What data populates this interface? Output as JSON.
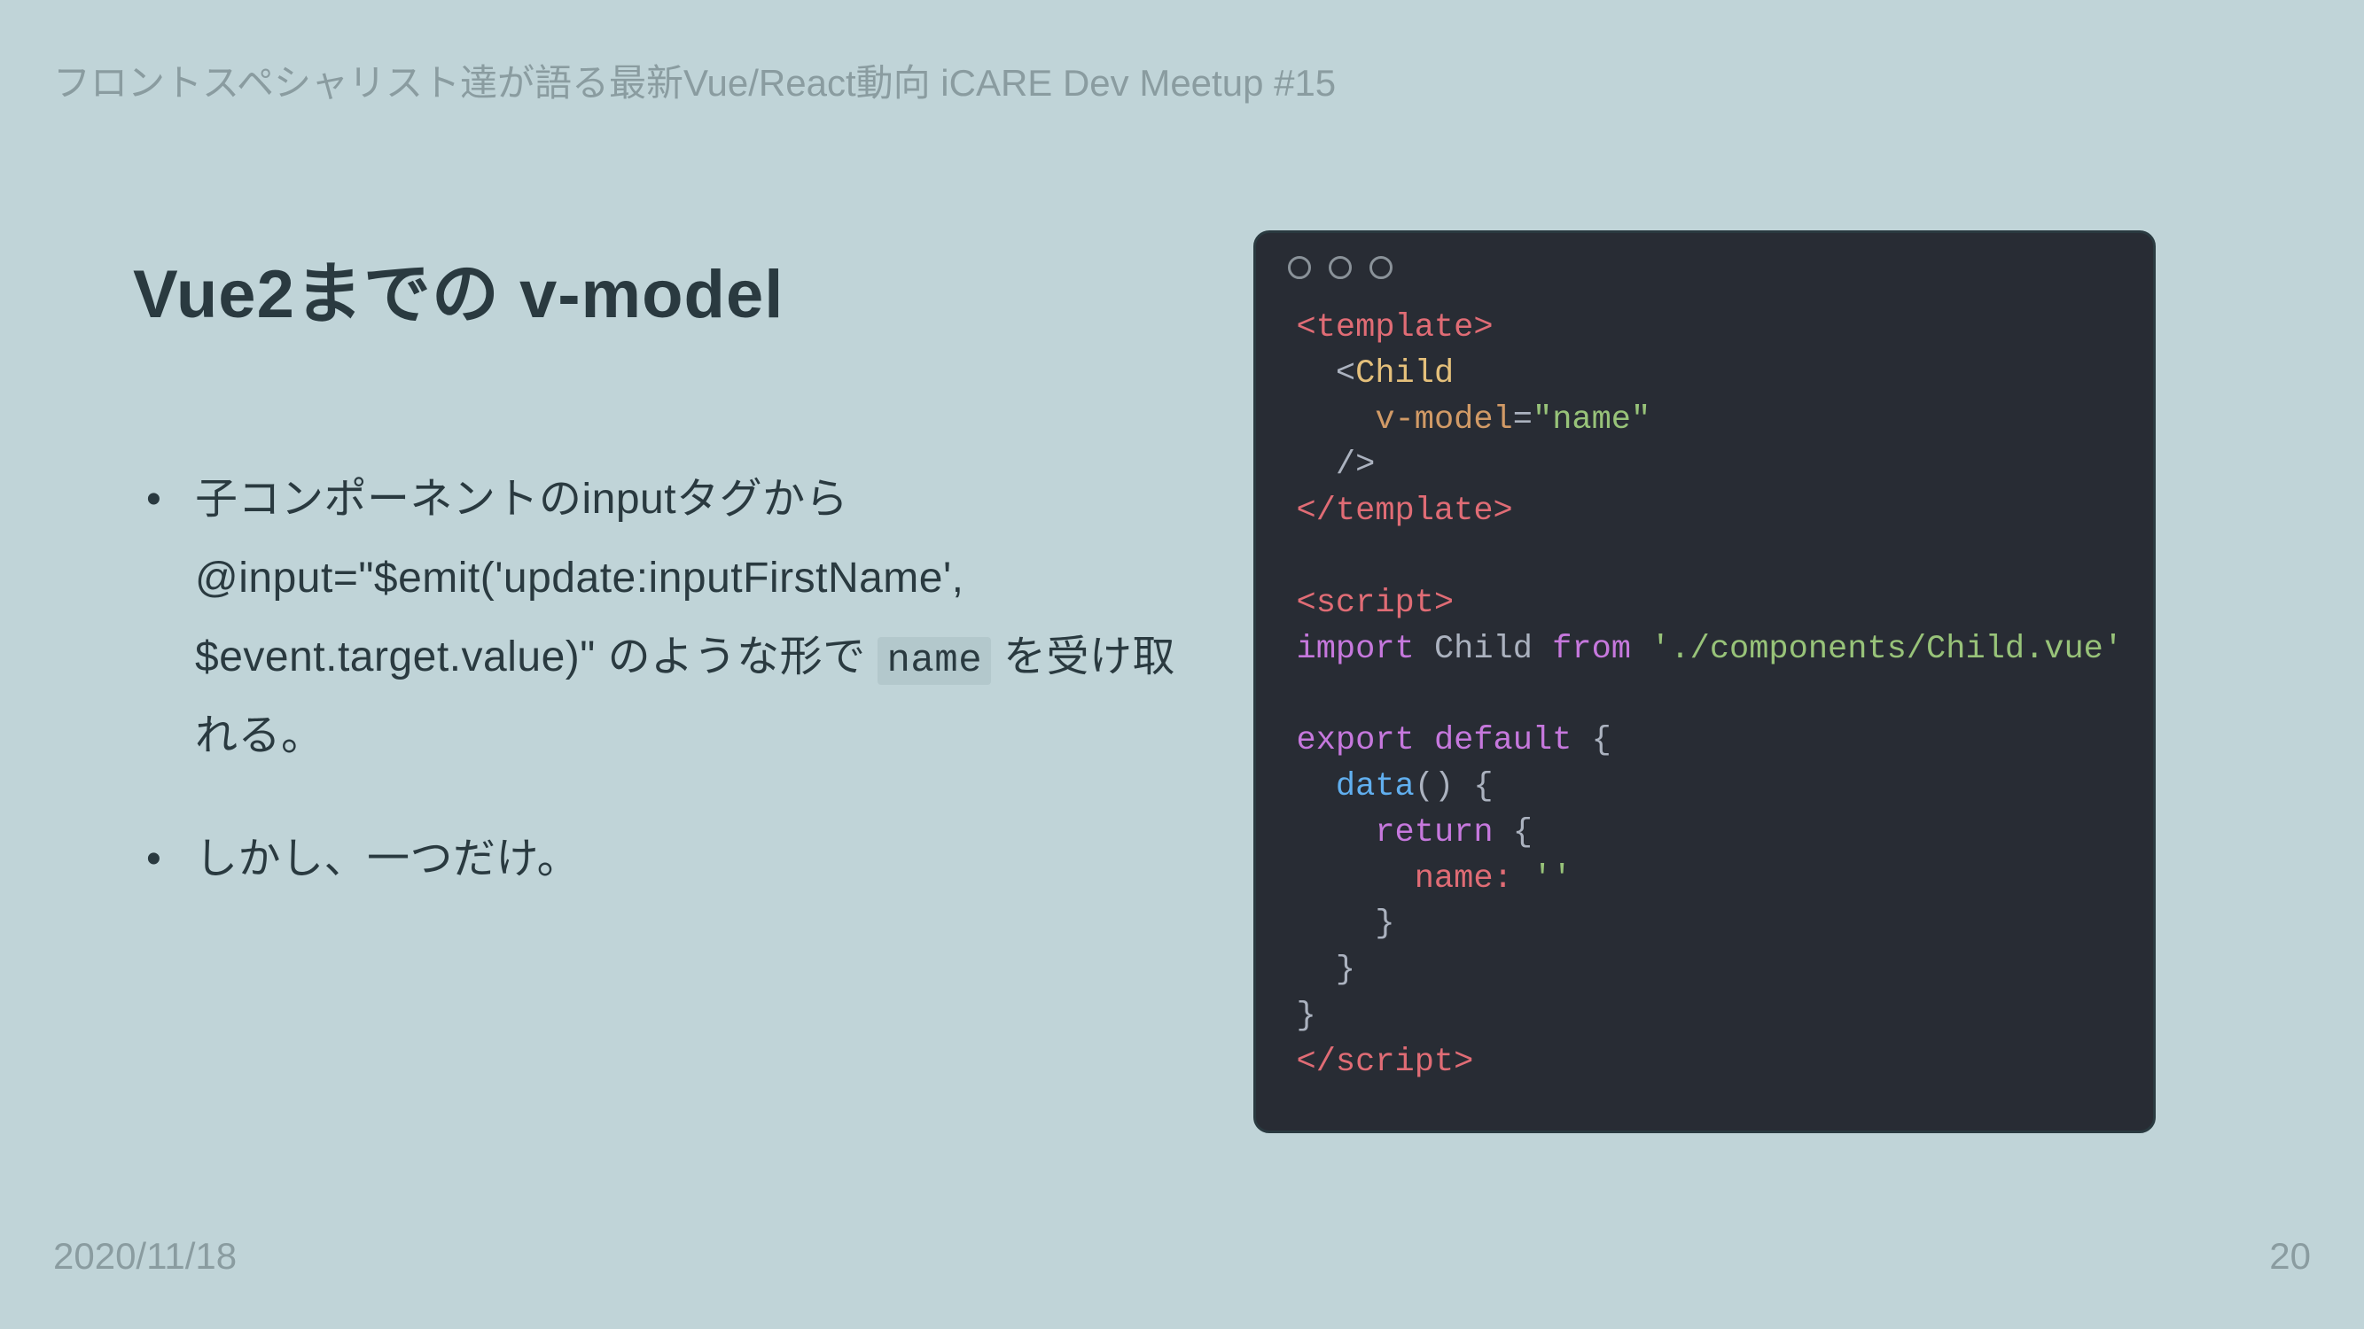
{
  "header": "フロントスペシャリスト達が語る最新Vue/React動向 iCARE Dev Meetup #15",
  "title": "Vue2までの v-model",
  "bullets": [
    {
      "pre": "子コンポーネントのinputタグから @input=\"$emit('update:inputFirstName', $event.target.value)\" のような形で ",
      "code": "name",
      "post": " を受け取れる。"
    },
    {
      "pre": "しかし、一つだけ。",
      "code": "",
      "post": ""
    }
  ],
  "code": {
    "l1": "<template>",
    "l2a": "  <",
    "l2b": "Child",
    "l3a": "    ",
    "l3b": "v-model",
    "l3c": "=",
    "l3d": "\"name\"",
    "l4": "  />",
    "l5": "</template>",
    "l6": "",
    "l7": "<script>",
    "l8a": "import",
    "l8b": " Child ",
    "l8c": "from",
    "l8d": " './components/Child.vue'",
    "l9": "",
    "l10a": "export",
    "l10b": " default",
    "l10c": " {",
    "l11a": "  ",
    "l11b": "data",
    "l11c": "() {",
    "l12a": "    ",
    "l12b": "return",
    "l12c": " {",
    "l13a": "      name: ",
    "l13b": "''",
    "l14": "    }",
    "l15": "  }",
    "l16": "}",
    "l17": "</script>"
  },
  "footer": {
    "date": "2020/11/18",
    "page": "20"
  }
}
